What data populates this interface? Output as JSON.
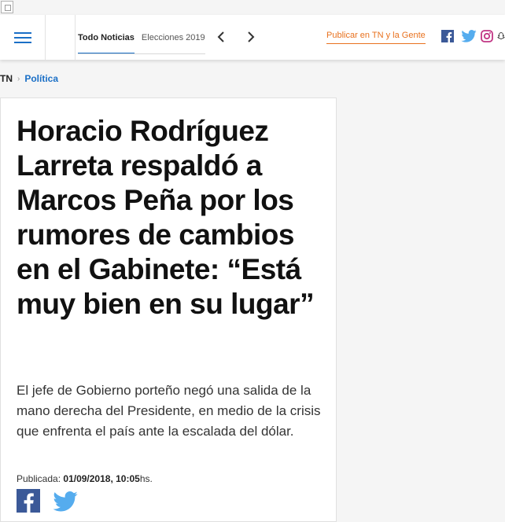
{
  "header": {
    "tabs": [
      "Todo Noticias",
      "Elecciones 2019"
    ],
    "publicar_label": "Publicar en TN y la Gente",
    "social": [
      "facebook-icon",
      "twitter-icon",
      "instagram-icon",
      "snapchat-icon"
    ]
  },
  "breadcrumb": {
    "home": "TN",
    "section": "Política"
  },
  "article": {
    "title": "Horacio Rodríguez Larreta respaldó a Marcos Peña por los rumores de cambios en el Gabinete: “Está muy bien en su lugar”",
    "lead": "El jefe de Gobierno porteño negó una salida de la mano derecha del Presidente, en medio de la crisis que enfrenta el país ante la escalada del dólar.",
    "published_label": "Publicada:",
    "published_date": "01/09/2018, 10:05",
    "published_suffix": "hs."
  },
  "colors": {
    "accent": "#1a6fc6",
    "orange": "#e8711e",
    "facebook": "#3b5998",
    "twitter": "#55acee",
    "instagram": "#c13584"
  }
}
